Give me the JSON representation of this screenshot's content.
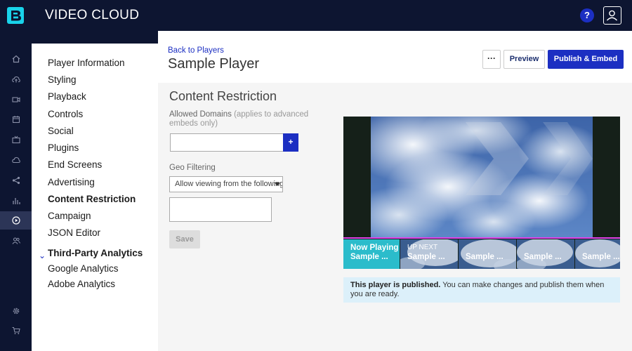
{
  "app": {
    "brand": "VIDEO CLOUD",
    "logo_icon": "brightcove-logo-icon",
    "help_label": "?"
  },
  "colors": {
    "accent": "#1c2fc2",
    "nav_bg": "#0d1531",
    "progress": "#e040e8",
    "notice_bg": "#dcf0fa"
  },
  "rail": {
    "icons": [
      "home-icon",
      "upload-icon",
      "video-icon",
      "calendar-icon",
      "tv-icon",
      "cloud-icon",
      "share-icon",
      "analytics-icon",
      "player-icon",
      "users-icon",
      "gear-icon",
      "cart-icon"
    ],
    "active": "player-icon"
  },
  "subnav": {
    "items": [
      "Player Information",
      "Styling",
      "Playback",
      "Controls",
      "Social",
      "Plugins",
      "End Screens",
      "Advertising",
      "Content Restriction",
      "Campaign",
      "JSON Editor"
    ],
    "active": "Content Restriction",
    "group_label": "Third-Party Analytics",
    "group_items": [
      "Google Analytics",
      "Adobe Analytics"
    ]
  },
  "header": {
    "back_link": "Back to Players",
    "title": "Sample Player",
    "more_label": "···",
    "preview_label": "Preview",
    "publish_label": "Publish & Embed"
  },
  "content": {
    "section_title": "Content Restriction",
    "domains_label": "Allowed Domains",
    "domains_hint": "(applies to advanced embeds only)",
    "domains_value": "",
    "add_label": "+",
    "geo_label": "Geo Filtering",
    "geo_selected": "Allow viewing from the following",
    "geo_countries": "",
    "save_label": "Save"
  },
  "player": {
    "thumbs": [
      {
        "line1": "Now Playing",
        "line2": "Sample ..."
      },
      {
        "line1": "UP NEXT",
        "line2": "Sample ..."
      },
      {
        "line1": "",
        "line2": "Sample ..."
      },
      {
        "line1": "",
        "line2": "Sample ..."
      },
      {
        "line1": "",
        "line2": "Sample ..."
      }
    ]
  },
  "notice": {
    "bold": "This player is published.",
    "text": " You can make changes and publish them when you are ready."
  }
}
